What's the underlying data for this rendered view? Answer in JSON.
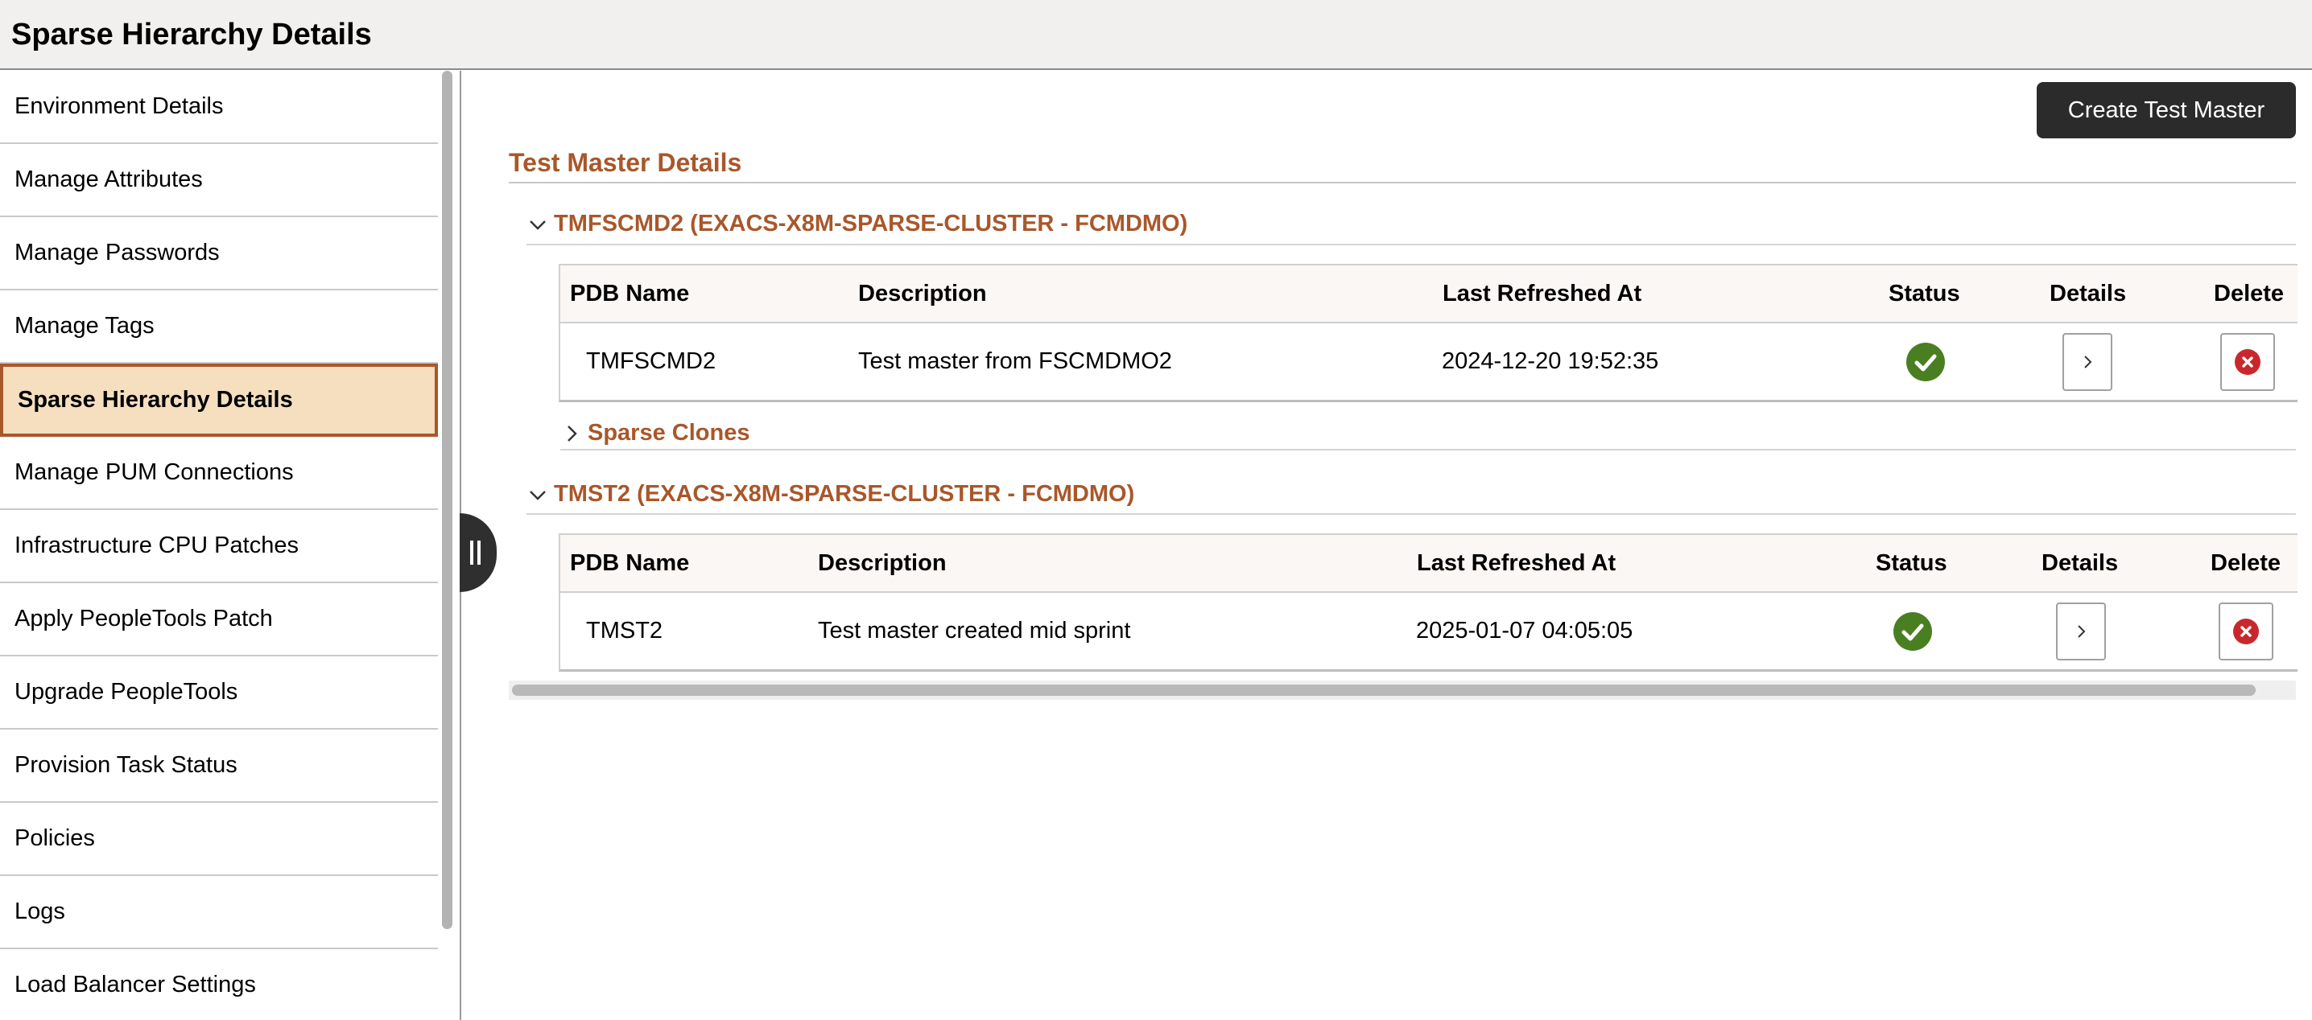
{
  "header": {
    "title": "Sparse Hierarchy Details"
  },
  "sidebar": {
    "items": [
      {
        "label": "Environment Details"
      },
      {
        "label": "Manage Attributes"
      },
      {
        "label": "Manage Passwords"
      },
      {
        "label": "Manage Tags"
      },
      {
        "label": "Sparse Hierarchy Details",
        "active": true
      },
      {
        "label": "Manage PUM Connections"
      },
      {
        "label": "Infrastructure CPU Patches"
      },
      {
        "label": "Apply PeopleTools Patch"
      },
      {
        "label": "Upgrade PeopleTools"
      },
      {
        "label": "Provision Task Status"
      },
      {
        "label": "Policies"
      },
      {
        "label": "Logs"
      },
      {
        "label": "Load Balancer Settings"
      }
    ]
  },
  "toolbar": {
    "create_label": "Create Test Master"
  },
  "main": {
    "section_title": "Test Master Details",
    "columns": {
      "pdb_name": "PDB Name",
      "description": "Description",
      "last_refreshed": "Last Refreshed At",
      "status": "Status",
      "details": "Details",
      "delete": "Delete"
    },
    "groups": [
      {
        "title": "TMFSCMD2 (EXACS-X8M-SPARSE-CLUSTER - FCMDMO)",
        "expanded": true,
        "row": {
          "pdb_name": "TMFSCMD2",
          "description": "Test master from FSCMDMO2",
          "last_refreshed": "2024-12-20 19:52:35",
          "status": "success-icon"
        },
        "subgroup": {
          "title": "Sparse Clones",
          "expanded": false
        }
      },
      {
        "title": "TMST2 (EXACS-X8M-SPARSE-CLUSTER - FCMDMO)",
        "expanded": true,
        "row": {
          "pdb_name": "TMST2",
          "description": "Test master created mid sprint",
          "last_refreshed": "2025-01-07 04:05:05",
          "status": "success-icon"
        }
      }
    ]
  },
  "colors": {
    "accent": "#a9572a",
    "active_bg": "#f5dfbe",
    "success": "#4a7f21",
    "danger": "#c8282d",
    "button_dark": "#2b2b2b"
  }
}
